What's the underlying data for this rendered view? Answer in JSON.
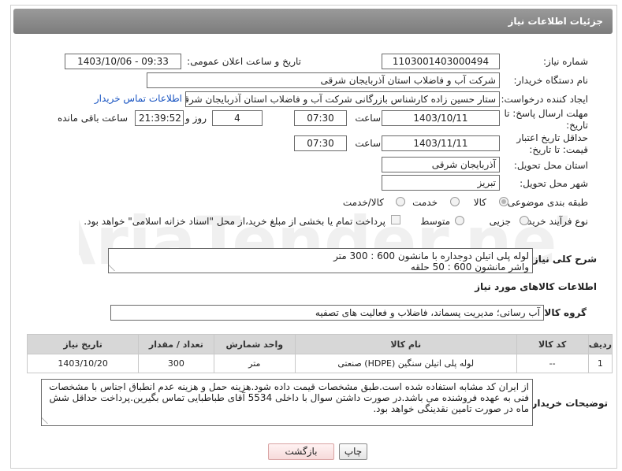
{
  "header": {
    "title": "جزئیات اطلاعات نیاز"
  },
  "fields": {
    "need_number": {
      "label": "شماره نیاز:",
      "value": "1103001403000494"
    },
    "announce_datetime": {
      "label": "تاریخ و ساعت اعلان عمومی:",
      "value": "1403/10/06 - 09:33"
    },
    "buyer_org": {
      "label": "نام دستگاه خریدار:",
      "value": "شرکت آب و فاضلاب استان آذربایجان شرقی"
    },
    "requester": {
      "label": "ایجاد کننده درخواست:",
      "value": "ستار حسین زاده کارشناس بازرگانی شرکت آب و فاضلاب استان آذربایجان شرقی",
      "link": "اطلاعات تماس خریدار"
    },
    "reply_deadline": {
      "label": "مهلت ارسال پاسخ: تا تاریخ:",
      "date": "1403/10/11",
      "time_label": "ساعت",
      "time": "07:30",
      "days": "4",
      "days_label": "روز و",
      "remaining": "21:39:52",
      "remaining_label": "ساعت باقی مانده"
    },
    "price_validity": {
      "label": "حداقل تاریخ اعتبار قیمت: تا تاریخ:",
      "date": "1403/11/11",
      "time_label": "ساعت",
      "time": "07:30"
    },
    "delivery_province": {
      "label": "استان محل تحویل:",
      "value": "آذربایجان شرقی"
    },
    "delivery_city": {
      "label": "شهر محل تحویل:",
      "value": "تبریز"
    },
    "category": {
      "label": "طبقه بندی موضوعی:",
      "options": [
        "کالا",
        "خدمت",
        "کالا/خدمت"
      ],
      "selected": "کالا"
    },
    "purchase_process": {
      "label": "نوع فرآیند خرید :",
      "options": [
        "جزیی",
        "متوسط"
      ],
      "checkbox_text": "پرداخت تمام یا بخشی از مبلغ خرید،از محل \"اسناد خزانه اسلامی\" خواهد بود."
    }
  },
  "summary": {
    "label": "شرح کلی نیاز:",
    "lines": [
      "لوله پلی اتیلن دوجداره با مانشون 600 : 300 متر",
      "واشر مانشون 600 : 50 حلقه"
    ]
  },
  "goods_info": {
    "title": "اطلاعات کالاهای مورد نیاز",
    "group_label": "گروه کالا:",
    "group_value": "آب رسانی؛ مدیریت پسماند، فاضلاب و فعالیت های تصفیه"
  },
  "table": {
    "headers": [
      "ردیف",
      "کد کالا",
      "نام کالا",
      "واحد شمارش",
      "تعداد / مقدار",
      "تاریخ نیاز"
    ],
    "rows": [
      [
        "1",
        "--",
        "لوله پلی اتیلن سنگین (HDPE) صنعتی",
        "متر",
        "300",
        "1403/10/20"
      ]
    ]
  },
  "buyer_notes": {
    "label": "توضیحات خریدار:",
    "text": "از ایران کد مشابه استفاده شده است.طبق مشخصات قیمت داده شود.هزینه حمل و هزینه عدم انطباق اجناس با مشخصات فنی به عهده فروشنده می باشد.در صورت داشتن سوال با داخلی 5534 آقای طباطبایی تماس بگیرین.پرداخت حداقل شش ماه در صورت تامین نقدینگی خواهد بود."
  },
  "buttons": {
    "print": "چاپ",
    "back": "بازگشت"
  },
  "watermark": "AriaTender.neT"
}
